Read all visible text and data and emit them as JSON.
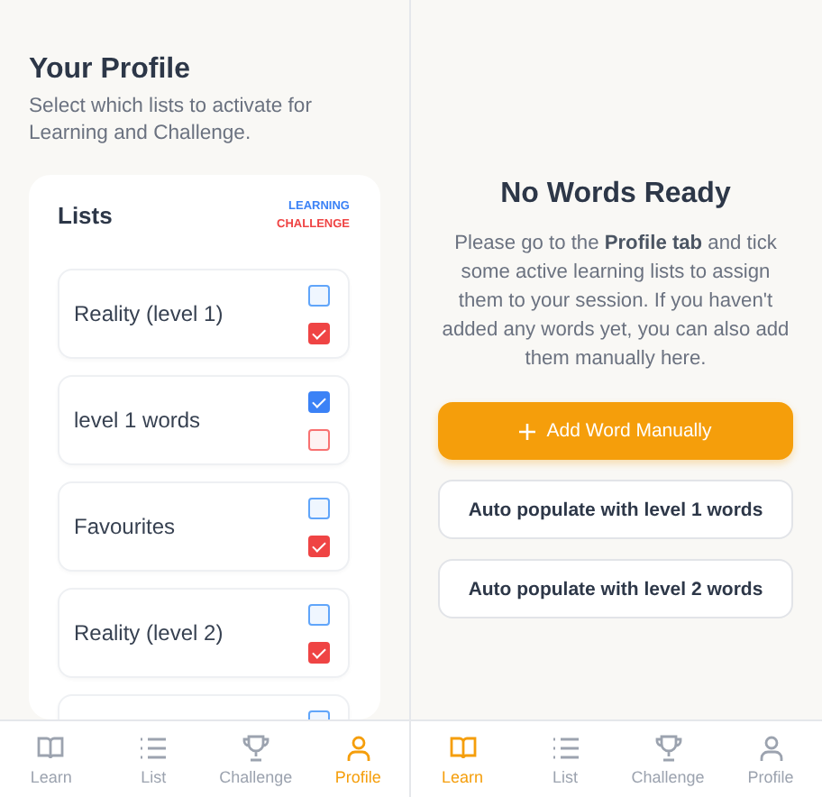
{
  "panels": [
    {
      "kind": "profile",
      "title": "Your Profile",
      "subtitle": "Select which lists to activate for Learning and Challenge.",
      "card": {
        "title": "Lists",
        "legend_learning": "LEARNING",
        "legend_challenge": "CHALLENGE",
        "lists": [
          {
            "name": "Reality (level 1)",
            "learning": false,
            "challenge": true
          },
          {
            "name": "level 1 words",
            "learning": true,
            "challenge": false
          },
          {
            "name": "Favourites",
            "learning": false,
            "challenge": true
          },
          {
            "name": "Reality (level 2)",
            "learning": false,
            "challenge": true
          },
          {
            "learning": false
          }
        ]
      },
      "nav": [
        {
          "label": "Learn",
          "selected": false
        },
        {
          "label": "List",
          "selected": false
        },
        {
          "label": "Challenge",
          "selected": false
        },
        {
          "label": "Profile",
          "selected": true
        }
      ]
    },
    {
      "kind": "learn",
      "title": "No Words Ready",
      "message": "Please go to the **Profile tab** and tick some active learning lists to assign them to your session. If you haven't added any words yet, you can also add them manually here.",
      "buttons": [
        {
          "label": "Add Word Manually",
          "kind": "primary"
        },
        {
          "label": "Auto populate with level 1 words",
          "kind": "outline"
        },
        {
          "label": "Auto populate with level 2 words",
          "kind": "outline"
        }
      ],
      "nav": [
        {
          "label": "Learn",
          "selected": true
        },
        {
          "label": "List",
          "selected": false
        },
        {
          "label": "Challenge",
          "selected": false
        },
        {
          "label": "Profile",
          "selected": false
        }
      ]
    }
  ]
}
